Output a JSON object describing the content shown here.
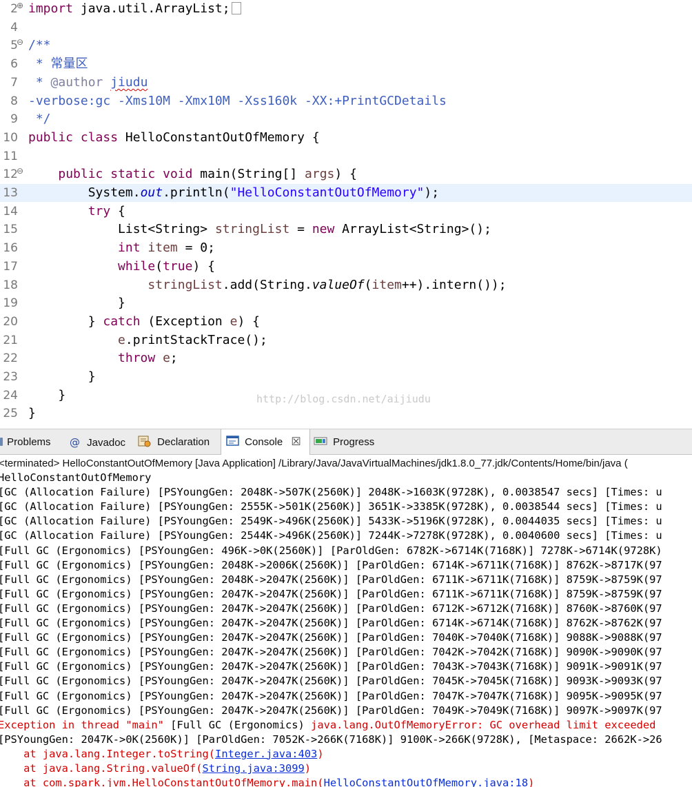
{
  "editor": {
    "lines": [
      {
        "num": "2",
        "marker": "⊕",
        "fold": true,
        "code": [
          {
            "t": "import",
            "c": "kw"
          },
          {
            "t": " java.util.ArrayList;"
          }
        ]
      },
      {
        "num": "4",
        "code": []
      },
      {
        "num": "5",
        "marker": "⊖",
        "code": [
          {
            "t": "/**",
            "c": "cm"
          }
        ]
      },
      {
        "num": "6",
        "code": [
          {
            "t": " * 常量区",
            "c": "cm"
          }
        ]
      },
      {
        "num": "7",
        "code": [
          {
            "t": " * ",
            "c": "cm"
          },
          {
            "t": "@author",
            "c": "tag"
          },
          {
            "t": " ",
            "c": "cm"
          },
          {
            "t": "jiudu",
            "c": "cm squig"
          }
        ]
      },
      {
        "num": "8",
        "code": [
          {
            "t": "-verbose:gc -Xms10M -Xmx10M -Xss160k -XX:+PrintGCDetails",
            "c": "cm"
          }
        ]
      },
      {
        "num": "9",
        "code": [
          {
            "t": " */",
            "c": "cm"
          }
        ]
      },
      {
        "num": "10",
        "code": [
          {
            "t": "public",
            "c": "kw"
          },
          {
            "t": " "
          },
          {
            "t": "class",
            "c": "kw"
          },
          {
            "t": " HelloConstantOutOfMemory {"
          }
        ]
      },
      {
        "num": "11",
        "code": []
      },
      {
        "num": "12",
        "marker": "⊖",
        "code": [
          {
            "t": "    "
          },
          {
            "t": "public",
            "c": "kw"
          },
          {
            "t": " "
          },
          {
            "t": "static",
            "c": "kw"
          },
          {
            "t": " "
          },
          {
            "t": "void",
            "c": "kw"
          },
          {
            "t": " main(String[] "
          },
          {
            "t": "args",
            "c": "lv"
          },
          {
            "t": ") {"
          }
        ]
      },
      {
        "num": "13",
        "hl": true,
        "code": [
          {
            "t": "        System."
          },
          {
            "t": "out",
            "c": "fld"
          },
          {
            "t": ".println("
          },
          {
            "t": "\"HelloConstantOutOfMemory\"",
            "c": "str"
          },
          {
            "t": ");"
          }
        ]
      },
      {
        "num": "14",
        "code": [
          {
            "t": "        "
          },
          {
            "t": "try",
            "c": "kw"
          },
          {
            "t": " {"
          }
        ]
      },
      {
        "num": "15",
        "code": [
          {
            "t": "            List<String> "
          },
          {
            "t": "stringList",
            "c": "lv"
          },
          {
            "t": " = "
          },
          {
            "t": "new",
            "c": "kw"
          },
          {
            "t": " ArrayList<String>();"
          }
        ]
      },
      {
        "num": "16",
        "code": [
          {
            "t": "            "
          },
          {
            "t": "int",
            "c": "kw"
          },
          {
            "t": " "
          },
          {
            "t": "item",
            "c": "lv"
          },
          {
            "t": " = 0;"
          }
        ]
      },
      {
        "num": "17",
        "code": [
          {
            "t": "            "
          },
          {
            "t": "while",
            "c": "kw"
          },
          {
            "t": "("
          },
          {
            "t": "true",
            "c": "kw"
          },
          {
            "t": ") {"
          }
        ]
      },
      {
        "num": "18",
        "code": [
          {
            "t": "                "
          },
          {
            "t": "stringList",
            "c": "lv"
          },
          {
            "t": ".add(String."
          },
          {
            "t": "valueOf",
            "c": "st"
          },
          {
            "t": "("
          },
          {
            "t": "item",
            "c": "lv"
          },
          {
            "t": "++).intern());"
          }
        ]
      },
      {
        "num": "19",
        "code": [
          {
            "t": "            }"
          }
        ]
      },
      {
        "num": "20",
        "code": [
          {
            "t": "        } "
          },
          {
            "t": "catch",
            "c": "kw"
          },
          {
            "t": " (Exception "
          },
          {
            "t": "e",
            "c": "lv"
          },
          {
            "t": ") {"
          }
        ]
      },
      {
        "num": "21",
        "code": [
          {
            "t": "            "
          },
          {
            "t": "e",
            "c": "lv"
          },
          {
            "t": ".printStackTrace();"
          }
        ]
      },
      {
        "num": "22",
        "code": [
          {
            "t": "            "
          },
          {
            "t": "throw",
            "c": "kw"
          },
          {
            "t": " "
          },
          {
            "t": "e",
            "c": "lv"
          },
          {
            "t": ";"
          }
        ]
      },
      {
        "num": "23",
        "code": [
          {
            "t": "        }"
          }
        ]
      },
      {
        "num": "24",
        "code": [
          {
            "t": "    }"
          }
        ]
      },
      {
        "num": "25",
        "code": [
          {
            "t": "}"
          }
        ]
      }
    ],
    "watermark": "http://blog.csdn.net/aijiudu"
  },
  "tabs": {
    "problems": "Problems",
    "javadoc": "Javadoc",
    "declaration": "Declaration",
    "console": "Console",
    "progress": "Progress",
    "close_glyph": "☒"
  },
  "console": {
    "header": "<terminated> HelloConstantOutOfMemory [Java Application] /Library/Java/JavaVirtualMachines/jdk1.8.0_77.jdk/Contents/Home/bin/java (",
    "lines": [
      {
        "segs": [
          {
            "t": "HelloConstantOutOfMemory"
          }
        ]
      },
      {
        "segs": [
          {
            "t": "[GC (Allocation Failure) [PSYoungGen: 2048K->507K(2560K)] 2048K->1603K(9728K), 0.0038547 secs] [Times: u"
          }
        ]
      },
      {
        "segs": [
          {
            "t": "[GC (Allocation Failure) [PSYoungGen: 2555K->501K(2560K)] 3651K->3385K(9728K), 0.0038544 secs] [Times: u"
          }
        ]
      },
      {
        "segs": [
          {
            "t": "[GC (Allocation Failure) [PSYoungGen: 2549K->496K(2560K)] 5433K->5196K(9728K), 0.0044035 secs] [Times: u"
          }
        ]
      },
      {
        "segs": [
          {
            "t": "[GC (Allocation Failure) [PSYoungGen: 2544K->496K(2560K)] 7244K->7278K(9728K), 0.0040600 secs] [Times: u"
          }
        ]
      },
      {
        "segs": [
          {
            "t": "[Full GC (Ergonomics) [PSYoungGen: 496K->0K(2560K)] [ParOldGen: 6782K->6714K(7168K)] 7278K->6714K(9728K)"
          }
        ]
      },
      {
        "segs": [
          {
            "t": "[Full GC (Ergonomics) [PSYoungGen: 2048K->2006K(2560K)] [ParOldGen: 6714K->6711K(7168K)] 8762K->8717K(97"
          }
        ]
      },
      {
        "segs": [
          {
            "t": "[Full GC (Ergonomics) [PSYoungGen: 2048K->2047K(2560K)] [ParOldGen: 6711K->6711K(7168K)] 8759K->8759K(97"
          }
        ]
      },
      {
        "segs": [
          {
            "t": "[Full GC (Ergonomics) [PSYoungGen: 2047K->2047K(2560K)] [ParOldGen: 6711K->6711K(7168K)] 8759K->8759K(97"
          }
        ]
      },
      {
        "segs": [
          {
            "t": "[Full GC (Ergonomics) [PSYoungGen: 2047K->2047K(2560K)] [ParOldGen: 6712K->6712K(7168K)] 8760K->8760K(97"
          }
        ]
      },
      {
        "segs": [
          {
            "t": "[Full GC (Ergonomics) [PSYoungGen: 2047K->2047K(2560K)] [ParOldGen: 6714K->6714K(7168K)] 8762K->8762K(97"
          }
        ]
      },
      {
        "segs": [
          {
            "t": "[Full GC (Ergonomics) [PSYoungGen: 2047K->2047K(2560K)] [ParOldGen: 7040K->7040K(7168K)] 9088K->9088K(97"
          }
        ]
      },
      {
        "segs": [
          {
            "t": "[Full GC (Ergonomics) [PSYoungGen: 2047K->2047K(2560K)] [ParOldGen: 7042K->7042K(7168K)] 9090K->9090K(97"
          }
        ]
      },
      {
        "segs": [
          {
            "t": "[Full GC (Ergonomics) [PSYoungGen: 2047K->2047K(2560K)] [ParOldGen: 7043K->7043K(7168K)] 9091K->9091K(97"
          }
        ]
      },
      {
        "segs": [
          {
            "t": "[Full GC (Ergonomics) [PSYoungGen: 2047K->2047K(2560K)] [ParOldGen: 7045K->7045K(7168K)] 9093K->9093K(97"
          }
        ]
      },
      {
        "segs": [
          {
            "t": "[Full GC (Ergonomics) [PSYoungGen: 2047K->2047K(2560K)] [ParOldGen: 7047K->7047K(7168K)] 9095K->9095K(97"
          }
        ]
      },
      {
        "segs": [
          {
            "t": "[Full GC (Ergonomics) [PSYoungGen: 2047K->2047K(2560K)] [ParOldGen: 7049K->7049K(7168K)] 9097K->9097K(97"
          }
        ]
      },
      {
        "segs": [
          {
            "t": "Exception in thread \"main\" ",
            "c": "err"
          },
          {
            "t": "[Full GC (Ergonomics) "
          },
          {
            "t": "java.lang.OutOfMemoryError: GC overhead limit exceeded",
            "c": "err"
          }
        ]
      },
      {
        "segs": [
          {
            "t": "[PSYoungGen: 2047K->0K(2560K)] [ParOldGen: 7052K->266K(7168K)] 9100K->266K(9728K), [Metaspace: 2662K->26"
          }
        ]
      },
      {
        "segs": [
          {
            "t": "    at java.lang.Integer.toString(",
            "c": "err"
          },
          {
            "t": "Integer.java:403",
            "c": "lnk"
          },
          {
            "t": ")",
            "c": "err"
          }
        ]
      },
      {
        "segs": [
          {
            "t": "    at java.lang.String.valueOf(",
            "c": "err"
          },
          {
            "t": "String.java:3099",
            "c": "lnk"
          },
          {
            "t": ")",
            "c": "err"
          }
        ]
      },
      {
        "segs": [
          {
            "t": "    at com.spark.jvm.HelloConstantOutOfMemory.main(",
            "c": "err"
          },
          {
            "t": "HelloConstantOutOfMemory.java:18",
            "c": "lnk"
          },
          {
            "t": ")",
            "c": "err"
          }
        ]
      }
    ]
  }
}
